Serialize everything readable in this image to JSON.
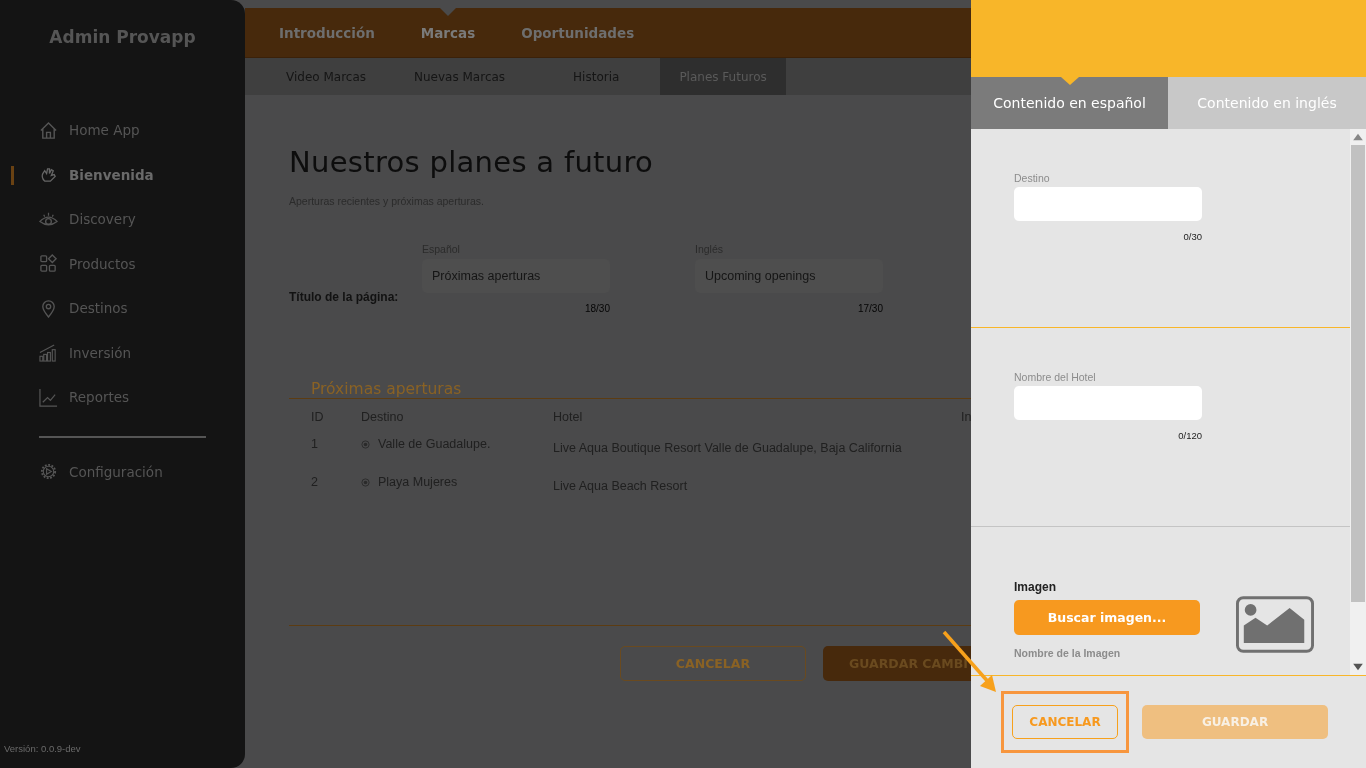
{
  "sidebar": {
    "title": "Admin Provapp",
    "items": [
      {
        "label": "Home App",
        "selected": false
      },
      {
        "label": "Bienvenida",
        "selected": true
      },
      {
        "label": "Discovery",
        "selected": false
      },
      {
        "label": "Productos",
        "selected": false
      },
      {
        "label": "Destinos",
        "selected": false
      },
      {
        "label": "Inversión",
        "selected": false
      },
      {
        "label": "Reportes",
        "selected": false
      }
    ],
    "footer_items": [
      {
        "label": "Configuración",
        "selected": false
      }
    ],
    "version": "Versión: 0.0.9-dev"
  },
  "top_tabs": [
    {
      "label": "Introducción",
      "selected": false
    },
    {
      "label": "Marcas",
      "selected": true
    },
    {
      "label": "Oportunidades",
      "selected": false
    }
  ],
  "sub_tabs": [
    {
      "label": "Video Marcas",
      "selected": false
    },
    {
      "label": "Nuevas Marcas",
      "selected": false
    },
    {
      "label": "Historia",
      "selected": false
    },
    {
      "label": "Planes Futuros",
      "selected": true
    }
  ],
  "page": {
    "title": "Nuestros planes a futuro",
    "subtitle": "Aperturas recientes y próximas aperturas.",
    "title_field": {
      "label": "Título de la página:",
      "inputs": [
        {
          "label": "Español",
          "value": "Próximas aperturas",
          "counter": "18/30"
        },
        {
          "label": "Inglés",
          "value": "Upcoming openings",
          "counter": "17/30"
        }
      ]
    },
    "section_title": "Próximas aperturas",
    "table": {
      "columns": [
        "ID",
        "Destino",
        "Hotel",
        "In"
      ],
      "rows": [
        {
          "id": "1",
          "destino": "Valle de Guadalupe.",
          "hotel": "Live Aqua Boutique Resort Valle de Guadalupe, Baja California"
        },
        {
          "id": "2",
          "destino": "Playa Mujeres",
          "hotel": "Live Aqua Beach Resort"
        }
      ]
    },
    "buttons": [
      {
        "label": "CANCELAR",
        "kind": "outline"
      },
      {
        "label": "GUARDAR CAMBI",
        "kind": "filled"
      }
    ]
  },
  "panel": {
    "tabs": [
      {
        "label": "Contenido en español",
        "selected": true
      },
      {
        "label": "Contenido en inglés",
        "selected": false
      }
    ],
    "sections": [
      {
        "kind": "text",
        "label": "Destino",
        "counter": "0/30"
      },
      {
        "kind": "text",
        "label": "Nombre del Hotel",
        "counter": "0/120"
      },
      {
        "kind": "image",
        "label": "Imagen",
        "button": "Buscar imagen...",
        "caption": "Nombre de la Imagen"
      }
    ],
    "buttons": [
      {
        "label": "CANCELAR",
        "kind": "outline",
        "disabled": false
      },
      {
        "label": "GUARDAR",
        "kind": "filled",
        "disabled": true
      }
    ]
  }
}
